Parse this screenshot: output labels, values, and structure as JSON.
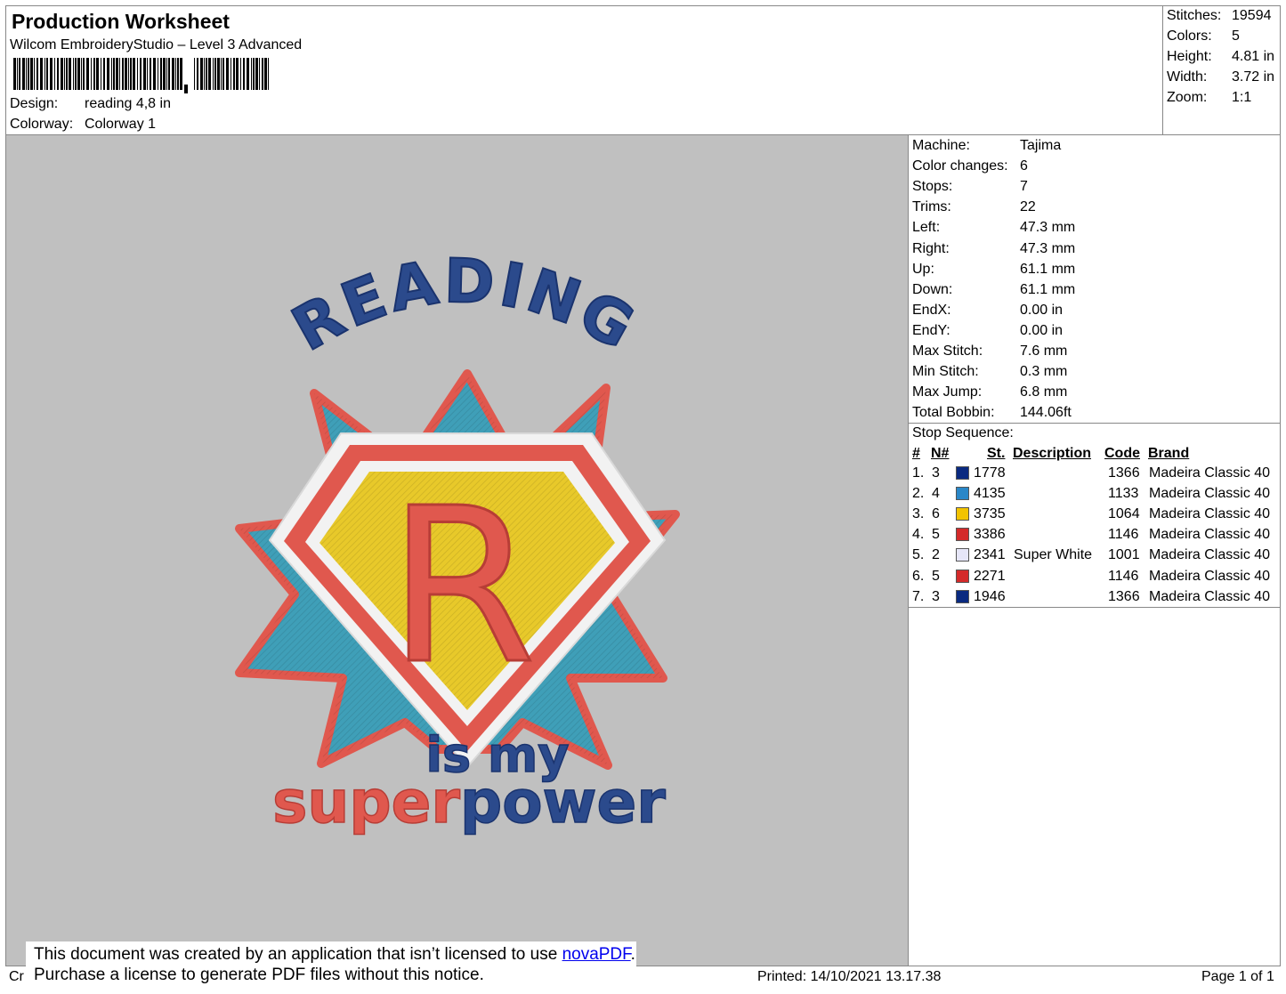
{
  "header": {
    "title": "Production Worksheet",
    "software": "Wilcom EmbroideryStudio – Level 3 Advanced",
    "design_label": "Design:",
    "design_value": "reading 4,8 in",
    "colorway_label": "Colorway:",
    "colorway_value": "Colorway 1"
  },
  "summary": [
    {
      "label": "Stitches:",
      "value": "19594"
    },
    {
      "label": "Colors:",
      "value": "5"
    },
    {
      "label": "Height:",
      "value": "4.81 in"
    },
    {
      "label": "Width:",
      "value": "3.72 in"
    },
    {
      "label": "Zoom:",
      "value": "1:1"
    }
  ],
  "machine_info": [
    {
      "label": "Machine:",
      "value": "Tajima"
    },
    {
      "label": "Color changes:",
      "value": "6"
    },
    {
      "label": "Stops:",
      "value": "7"
    },
    {
      "label": "Trims:",
      "value": "22"
    },
    {
      "label": "Left:",
      "value": "47.3 mm"
    },
    {
      "label": "Right:",
      "value": "47.3 mm"
    },
    {
      "label": "Up:",
      "value": "61.1 mm"
    },
    {
      "label": "Down:",
      "value": "61.1 mm"
    },
    {
      "label": "EndX:",
      "value": "0.00 in"
    },
    {
      "label": "EndY:",
      "value": "0.00 in"
    },
    {
      "label": "Max Stitch:",
      "value": "7.6 mm"
    },
    {
      "label": "Min Stitch:",
      "value": "0.3 mm"
    },
    {
      "label": "Max Jump:",
      "value": "6.8 mm"
    },
    {
      "label": "Total Bobbin:",
      "value": "144.06ft"
    }
  ],
  "stop_sequence": {
    "title": "Stop Sequence:",
    "headers": {
      "num": "#",
      "n": "N#",
      "st": "St.",
      "description": "Description",
      "code": "Code",
      "brand": "Brand"
    },
    "rows": [
      {
        "num": "1.",
        "n": "3",
        "color": "#0a2a80",
        "st": "1778",
        "description": "",
        "code": "1366",
        "brand": "Madeira Classic 40"
      },
      {
        "num": "2.",
        "n": "4",
        "color": "#2a87c8",
        "st": "4135",
        "description": "",
        "code": "1133",
        "brand": "Madeira Classic 40"
      },
      {
        "num": "3.",
        "n": "6",
        "color": "#f2c300",
        "st": "3735",
        "description": "",
        "code": "1064",
        "brand": "Madeira Classic 40"
      },
      {
        "num": "4.",
        "n": "5",
        "color": "#d42a2a",
        "st": "3386",
        "description": "",
        "code": "1146",
        "brand": "Madeira Classic 40"
      },
      {
        "num": "5.",
        "n": "2",
        "color": "#e6e6f8",
        "st": "2341",
        "description": "Super White",
        "code": "1001",
        "brand": "Madeira Classic 40"
      },
      {
        "num": "6.",
        "n": "5",
        "color": "#d42a2a",
        "st": "2271",
        "description": "",
        "code": "1146",
        "brand": "Madeira Classic 40"
      },
      {
        "num": "7.",
        "n": "3",
        "color": "#0a2a80",
        "st": "1946",
        "description": "",
        "code": "1366",
        "brand": "Madeira Classic 40"
      }
    ]
  },
  "design_art": {
    "word_top": "READING",
    "monogram": "R",
    "line_two": "is my",
    "line_three_a": "super",
    "line_three_b": "power",
    "colors": {
      "navy": "#2b4a8c",
      "teal": "#3f9fb8",
      "yellow": "#e8c92a",
      "coral": "#e0584e",
      "white": "#f2f2f2"
    }
  },
  "footer": {
    "left_stub": "Cr",
    "notice_line1_prefix": "This document was created by an application that isn’t licensed to use ",
    "notice_link": "novaPDF",
    "notice_line1_suffix": ".",
    "notice_line2": "Purchase a license to generate PDF files without this notice.",
    "printed": "Printed: 14/10/2021 13.17.38",
    "page": "Page 1 of 1"
  }
}
